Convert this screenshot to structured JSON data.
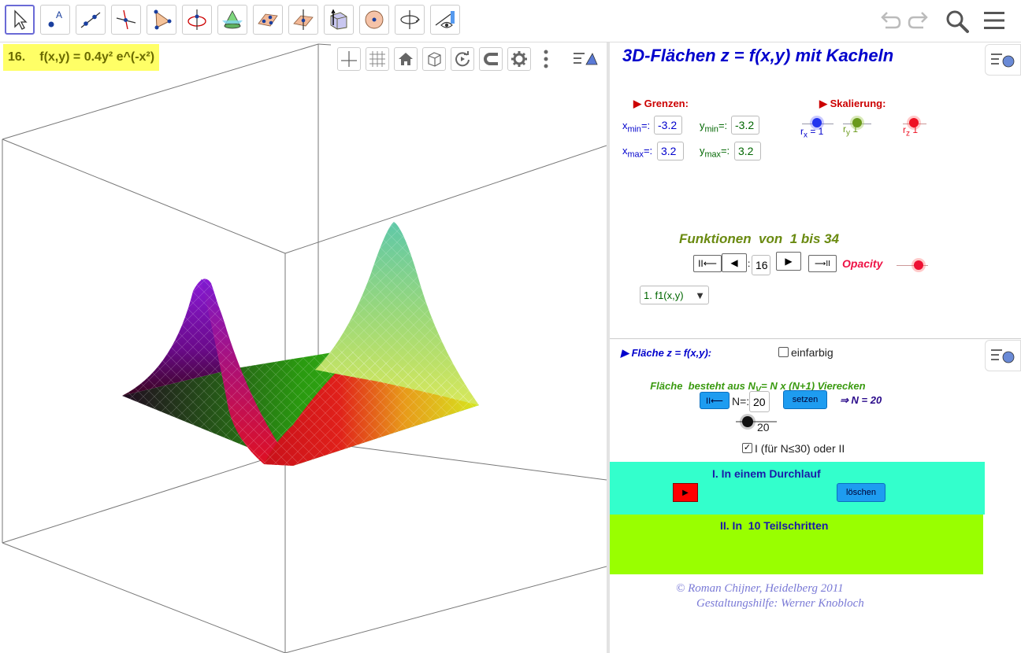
{
  "toolbar": {
    "tools": [
      "move-tool",
      "point-tool",
      "line-tool",
      "perpendicular-line-tool",
      "polygon-tool",
      "circle-with-axis-tool",
      "intersect-surfaces-tool",
      "plane-through-points-tool",
      "perpendicular-plane-tool",
      "prism-tool",
      "sphere-tool",
      "rotate-view-tool",
      "show-hide-tool"
    ],
    "undo_icon": "undo-icon",
    "redo_icon": "redo-icon",
    "search_icon": "search-icon",
    "menu_icon": "hamburger-menu-icon"
  },
  "graphics": {
    "function_label_num": "16.",
    "function_label": "f(x,y) = 0.4y² e^(-x²)",
    "view_tools": [
      "axes-toggle-icon",
      "grid-toggle-icon",
      "home-icon",
      "view-direction-icon",
      "rotate-view-icon",
      "snap-magnet-icon",
      "settings-gear-icon",
      "more-vertical-icon",
      "style-bar-toggle-icon"
    ]
  },
  "panel": {
    "title": "3D-Flächen z = f(x,y) mit Kacheln",
    "grenzen_label": "Grenzen:",
    "skalierung_label": "Skalierung:",
    "xmin_label": "x",
    "xmin_sub": "min",
    "xmin_value": "-3.2",
    "xmax_label": "x",
    "xmax_sub": "max",
    "xmax_value": "3.2",
    "ymin_label": "y",
    "ymin_sub": "min",
    "ymin_value": "-3.2",
    "ymax_label": "y",
    "ymax_sub": "max",
    "ymax_value": "3.2",
    "rx_label": "r",
    "rx_sub": "x",
    "rx_value": "= 1",
    "ry_label": "r",
    "ry_sub": "y",
    "ry_value": "1",
    "rz_label": "r",
    "rz_sub": "z",
    "rz_value": "1",
    "funktionen_label": "Funktionen  von  1 bis 34",
    "first_btn": "II⟵",
    "prev_btn": "◀",
    "current_index": "16",
    "next_btn": "▶",
    "last_btn": "⟶II",
    "opacity_label": "Opacity",
    "select_value": "1.   f1(x,y)",
    "flaeche_label": "Fläche z =  f(x,y):",
    "einfarbig_label": "einfarbig",
    "besteht_label_a": "Fläche  besteht aus N",
    "besteht_sub": "V",
    "besteht_label_b": "= N x (N+1) Vierecken",
    "reset_n_btn": "II⟵",
    "n_label": "N=:",
    "n_value": "20",
    "setzen_btn": "setzen",
    "n_result": "⇒ N = 20",
    "slider_value": "20",
    "mode_label": "I (für N≤30) oder II",
    "section1_title": "I. In einem Durchlauf",
    "play_btn": "▶",
    "loeschen_btn": "löschen",
    "section2_title": "II. In  10 Teilschritten",
    "credit1": "© Roman Chijner, Heidelberg 2011",
    "credit2": "Gestaltungshilfe: Werner Knobloch"
  },
  "colors": {
    "accent": "#0000cc",
    "label_bg": "#ffff66",
    "section1_bg": "#33ffcc",
    "section2_bg": "#99ff00",
    "button_blue": "#1e9cf0"
  }
}
